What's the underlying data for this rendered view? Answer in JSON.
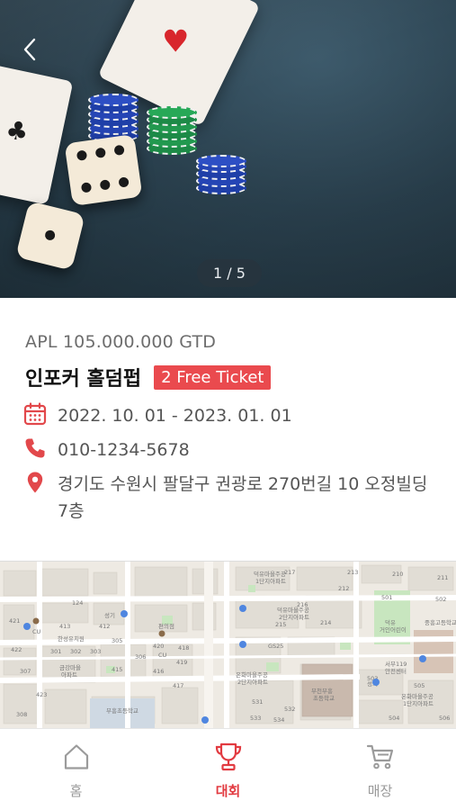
{
  "hero": {
    "counter": "1 / 5"
  },
  "event": {
    "price": "APL 105.000.000 GTD",
    "title": "인포커 홀덤펍",
    "badge": "2 Free Ticket",
    "date": "2022. 10. 01 - 2023. 01. 01",
    "phone": "010-1234-5678",
    "address": "경기도 수원시 팔달구 권광로 270번길 10 오정빌딩 7층"
  },
  "map": {
    "labels": [
      "덕유마을주공 1단지아파트",
      "덕유마을주공 2단지아파트",
      "한성유치원",
      "금강마을 아파트",
      "온화마을주공 2단지아파트",
      "부천부흥 초등학교",
      "부흥초등학교",
      "온화마을주공 1단지아파트",
      "덕유 거인어린이",
      "중흥고등학교",
      "성기",
      "CU",
      "GS25",
      "편의점",
      "서부119 안전센터"
    ],
    "numbers": [
      "217",
      "213",
      "216",
      "215",
      "214",
      "212",
      "210",
      "211",
      "124",
      "413",
      "412",
      "418",
      "417",
      "416",
      "415",
      "419",
      "421",
      "422",
      "420",
      "423",
      "531",
      "532",
      "533",
      "534",
      "501",
      "502",
      "503",
      "505",
      "504",
      "506",
      "306",
      "305",
      "303",
      "302",
      "301",
      "307",
      "308"
    ]
  },
  "nav": {
    "items": [
      {
        "label": "홈",
        "icon": "home-icon",
        "active": false
      },
      {
        "label": "대회",
        "icon": "trophy-icon",
        "active": true
      },
      {
        "label": "매장",
        "icon": "cart-icon",
        "active": false
      }
    ]
  },
  "colors": {
    "accent": "#e23b41",
    "badge": "#ea4a4e",
    "icon_red": "#e2484b"
  }
}
